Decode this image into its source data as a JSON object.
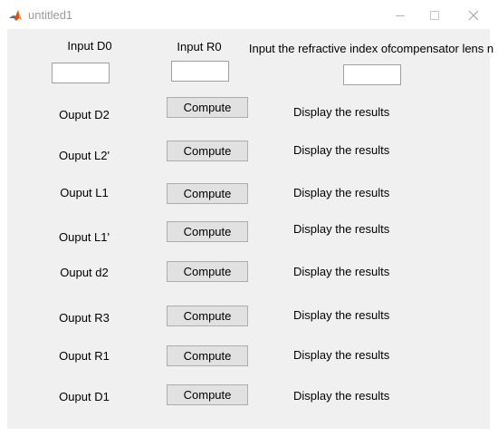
{
  "window": {
    "title": "untitled1"
  },
  "inputs": {
    "d0_label": "Input D0",
    "r0_label": "Input R0",
    "n_label": "Input the refractive index ofcompensator lens n",
    "d0_value": "",
    "r0_value": "",
    "n_value": ""
  },
  "rows": [
    {
      "label": "Ouput D2",
      "button": "Compute",
      "result": "Display the results"
    },
    {
      "label": "Ouput L2'",
      "button": "Compute",
      "result": "Display the results"
    },
    {
      "label": "Ouput L1",
      "button": "Compute",
      "result": "Display the results"
    },
    {
      "label": "Ouput L1'",
      "button": "Compute",
      "result": "Display the results"
    },
    {
      "label": "Ouput d2",
      "button": "Compute",
      "result": "Display the results"
    },
    {
      "label": "Ouput R3",
      "button": "Compute",
      "result": "Display the results"
    },
    {
      "label": "Ouput R1",
      "button": "Compute",
      "result": "Display the results"
    },
    {
      "label": "Ouput D1",
      "button": "Compute",
      "result": "Display the results"
    }
  ],
  "icons": {
    "app": "matlab-logo-icon",
    "minimize": "minimize-icon",
    "maximize": "maximize-icon",
    "close": "close-icon"
  }
}
